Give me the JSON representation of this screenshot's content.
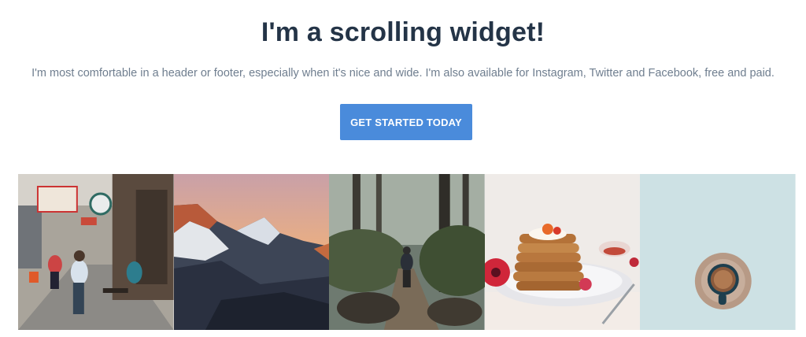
{
  "hero": {
    "title": "I'm a scrolling widget!",
    "subtitle": "I'm most comfortable in a header or footer, especially when it's nice and wide. I'm also available for Instagram, Twitter and Facebook, free and paid.",
    "cta_label": "GET STARTED TODAY"
  },
  "gallery": {
    "photos": [
      {
        "subject": "street scene"
      },
      {
        "subject": "mountain peaks at sunset"
      },
      {
        "subject": "hiker on forest trail"
      },
      {
        "subject": "stack of pancakes"
      },
      {
        "subject": "coffee cup on blue background"
      }
    ]
  },
  "colors": {
    "title": "#243447",
    "subtitle": "#6f7e8f",
    "button": "#4a8bdb"
  }
}
